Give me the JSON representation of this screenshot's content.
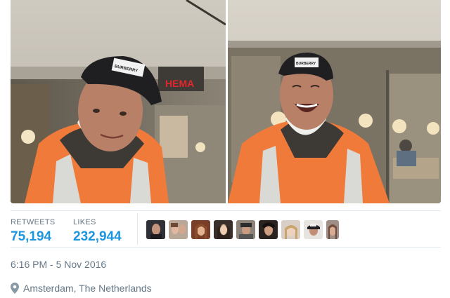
{
  "stats": {
    "retweets_label": "RETWEETS",
    "retweets_value": "75,194",
    "likes_label": "LIKES",
    "likes_value": "232,944"
  },
  "liker_avatars_count": 9,
  "timestamp": "6:16 PM - 5 Nov 2016",
  "location": {
    "icon": "location-pin-icon",
    "text": "Amsterdam, The Netherlands"
  },
  "photos": {
    "sign_text": "HEMA",
    "cap_text": "BURBERRY"
  },
  "colors": {
    "accent": "#1b95e0",
    "muted": "#657786",
    "divider": "#e1e8ed",
    "jacket": "#f07a3a",
    "sign": "#e3262d"
  }
}
